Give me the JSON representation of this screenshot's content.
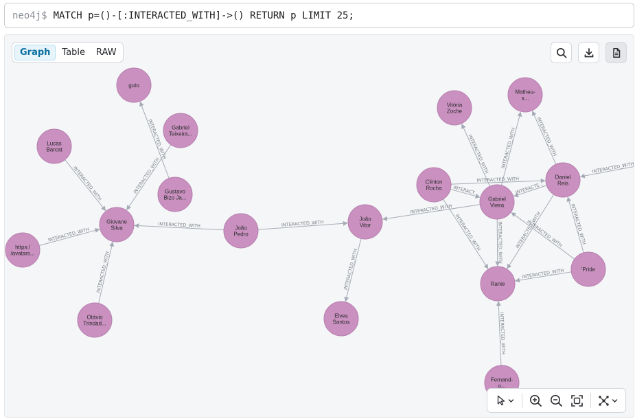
{
  "query": {
    "prompt": "neo4j$",
    "text": "MATCH p=()-[:INTERACTED_WITH]->() RETURN p LIMIT 25;"
  },
  "view_tabs": [
    {
      "label": "Graph",
      "active": true
    },
    {
      "label": "Table",
      "active": false
    },
    {
      "label": "RAW",
      "active": false
    }
  ],
  "toolbar": {
    "icons": [
      "search-icon",
      "download-icon",
      "document-icon"
    ]
  },
  "bottom_toolbar": {
    "icons": [
      "cursor-icon",
      "chevron-down-icon",
      "zoom-in-icon",
      "zoom-out-icon",
      "fit-screen-icon",
      "layout-icon",
      "chevron-down-icon"
    ]
  },
  "colors": {
    "node_fill": "#c990c0",
    "edge": "#a5abb6",
    "accent": "#0a6fa0"
  },
  "graph": {
    "relationship_label": "INTERACTED_WITH",
    "nodes": [
      {
        "id": "guto",
        "lines": [
          "guto"
        ]
      },
      {
        "id": "gabriel_t",
        "lines": [
          "Gabriel",
          "Teixeira..."
        ]
      },
      {
        "id": "lucas",
        "lines": [
          "Lucas",
          "Barcat"
        ]
      },
      {
        "id": "gustavo",
        "lines": [
          "Gustavo",
          "Bizo Ja..."
        ]
      },
      {
        "id": "giovane",
        "lines": [
          "Giovane",
          "Silva"
        ]
      },
      {
        "id": "https",
        "lines": [
          "https:/",
          "/avatars..."
        ]
      },
      {
        "id": "otavio",
        "lines": [
          "Otávio",
          "Trindad..."
        ]
      },
      {
        "id": "joao_pedro",
        "lines": [
          "João",
          "Pedro"
        ]
      },
      {
        "id": "joao_vitor",
        "lines": [
          "João",
          "Vitor"
        ]
      },
      {
        "id": "elves",
        "lines": [
          "Elves",
          "Santos"
        ]
      },
      {
        "id": "vitoria",
        "lines": [
          "Vitória",
          "Zoche"
        ]
      },
      {
        "id": "matheus",
        "lines": [
          "Matheu-",
          "s..."
        ]
      },
      {
        "id": "clinton",
        "lines": [
          "Clinton",
          "Rocha"
        ]
      },
      {
        "id": "gabriel_v",
        "lines": [
          "Gabriel",
          "Vieira"
        ]
      },
      {
        "id": "daniel",
        "lines": [
          "Daniel",
          "Reis"
        ]
      },
      {
        "id": "pride",
        "lines": [
          "'Pride"
        ]
      },
      {
        "id": "ranie",
        "lines": [
          "Ranie"
        ]
      },
      {
        "id": "fernando",
        "lines": [
          "Fernand-",
          "o..."
        ]
      }
    ],
    "edges": [
      {
        "from": "gustavo",
        "to": "guto",
        "label": "INTERACTED_WITH"
      },
      {
        "from": "gabriel_t",
        "to": "giovane",
        "label": "INTERACTED_WITH"
      },
      {
        "from": "lucas",
        "to": "giovane",
        "label": "INTERACTED_WITH"
      },
      {
        "from": "https",
        "to": "giovane",
        "label": "INTERACTED_WITH"
      },
      {
        "from": "otavio",
        "to": "giovane",
        "label": "INTERACTED_WITH"
      },
      {
        "from": "joao_pedro",
        "to": "giovane",
        "label": "INTERACTED_WITH"
      },
      {
        "from": "joao_pedro",
        "to": "joao_vitor",
        "label": "INTERACTED_WITH"
      },
      {
        "from": "joao_vitor",
        "to": "elves",
        "label": "INTERACTED_WITH"
      },
      {
        "from": "gabriel_v",
        "to": "joao_vitor",
        "label": "INTERACTED_WITH"
      },
      {
        "from": "gabriel_v",
        "to": "vitoria",
        "label": "INTERACTED_WITH"
      },
      {
        "from": "gabriel_v",
        "to": "matheus",
        "label": "INTERACTED_WITH"
      },
      {
        "from": "daniel",
        "to": "matheus",
        "label": "INTERACTED_WITH"
      },
      {
        "from": "clinton",
        "to": "gabriel_v",
        "label": "INTERACT..."
      },
      {
        "from": "clinton",
        "to": "daniel",
        "label": "INTERACTED_WITH"
      },
      {
        "from": "daniel",
        "to": "gabriel_v",
        "label": "INTERACTE..."
      },
      {
        "from": "clinton",
        "to": "ranie",
        "label": "INTERACTED_WITH"
      },
      {
        "from": "gabriel_v",
        "to": "ranie",
        "label": "INTERACTED_WITH"
      },
      {
        "from": "daniel",
        "to": "ranie",
        "label": "INTERACTED_WITH"
      },
      {
        "from": "pride",
        "to": "ranie",
        "label": "INTERACTED_WITH"
      },
      {
        "from": "pride",
        "to": "daniel",
        "label": "INTERACTED_WITH"
      },
      {
        "from": "pride",
        "to": "gabriel_v",
        "label": "INTERACTED_WITH"
      },
      {
        "from": "fernando",
        "to": "ranie",
        "label": "INTERACTED_WITH"
      },
      {
        "from": "offscreen",
        "to": "daniel",
        "label": "INTERACTED_WITH"
      }
    ]
  }
}
